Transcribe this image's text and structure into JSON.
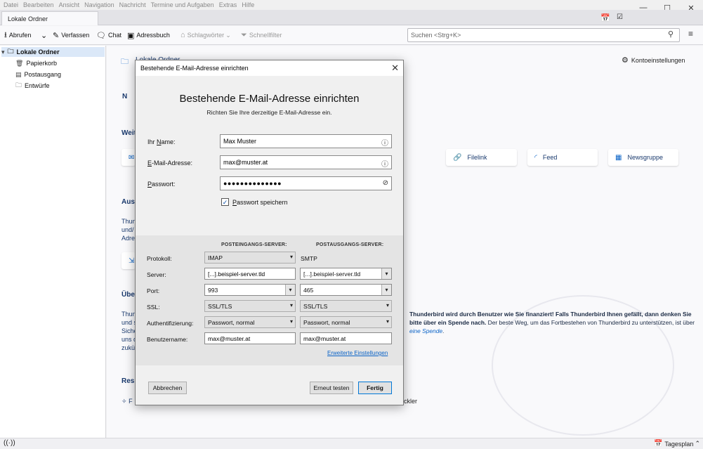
{
  "menu": [
    "Datei",
    "Bearbeiten",
    "Ansicht",
    "Navigation",
    "Nachricht",
    "Termine und Aufgaben",
    "Extras",
    "Hilfe"
  ],
  "window_controls": {
    "minimize": "—",
    "maximize": "☐",
    "close": "✕"
  },
  "tab": {
    "label": "Lokale Ordner"
  },
  "toolbar": {
    "get_messages": "Abrufen",
    "write": "Verfassen",
    "chat": "Chat",
    "address_book": "Adressbuch",
    "tags": "Schlagwörter",
    "quick_filter": "Schnellfilter",
    "search_placeholder": "Suchen <Strg+K>"
  },
  "folders": {
    "root": "Lokale Ordner",
    "items": [
      "Papierkorb",
      "Postausgang",
      "Entwürfe"
    ]
  },
  "background": {
    "header_title": "Lokale Ordner",
    "account_settings": "Kontoeinstellungen",
    "frag_n": "N",
    "frag_weit": "Weit",
    "cards": [
      "Filelink",
      "Feed",
      "Newsgruppe"
    ],
    "frag_aus": "Aus",
    "frag_thun1": "Thun",
    "frag_undi": "und/",
    "frag_adres": "Adres",
    "frag_ueber": "Über",
    "frag_thun2": "Thun",
    "frag_unds": "und s",
    "frag_siche": "Siche",
    "frag_unsd": "uns d",
    "frag_zuku": "zukü",
    "frag_ress": "Ress",
    "frag_f": "F",
    "frag_ckler": "ckler",
    "donation_bold": "Thunderbird wird durch Benutzer wie Sie finanziert! Falls Thunderbird Ihnen gefällt, dann denken Sie bitte über ein Spende nach.",
    "donation_rest": " Der beste Weg, um das Fortbestehen von Thunderbird zu unterstützen, ist über ",
    "donation_link": "eine Spende",
    "donation_end": "."
  },
  "statusbar": {
    "today_pane": "Tagesplan"
  },
  "dialog": {
    "title": "Bestehende E-Mail-Adresse einrichten",
    "heading": "Bestehende E-Mail-Adresse einrichten",
    "subheading": "Richten Sie Ihre derzeitige E-Mail-Adresse ein.",
    "name_label_pre": "Ihr ",
    "name_label_u": "N",
    "name_label_post": "ame:",
    "name_value": "Max Muster",
    "email_label_u": "E",
    "email_label_post": "-Mail-Adresse:",
    "email_value": "max@muster.at",
    "password_label_u": "P",
    "password_label_post": "asswort:",
    "password_value": "●●●●●●●●●●●●●●",
    "save_password_u": "P",
    "save_password_post": "asswort speichern",
    "save_password_checked": true,
    "incoming_header": "POSTEINGANGS-SERVER:",
    "outgoing_header": "POSTAUSGANGS-SERVER:",
    "labels": {
      "protocol": "Protokoll:",
      "server": "Server:",
      "port": "Port:",
      "ssl": "SSL:",
      "auth": "Authentifizierung:",
      "username": "Benutzername:"
    },
    "incoming": {
      "protocol": "IMAP",
      "server": "[...].beispiel-server.tld",
      "port": "993",
      "ssl": "SSL/TLS",
      "auth": "Passwort, normal",
      "username": "max@muster.at"
    },
    "outgoing": {
      "protocol": "SMTP",
      "server": "[...].beispiel-server.tld",
      "port": "465",
      "ssl": "SSL/TLS",
      "auth": "Passwort, normal",
      "username": "max@muster.at"
    },
    "advanced_link": "Erweiterte Einstellungen",
    "cancel": "Abbrechen",
    "retest": "Erneut testen",
    "done": "Fertig"
  }
}
